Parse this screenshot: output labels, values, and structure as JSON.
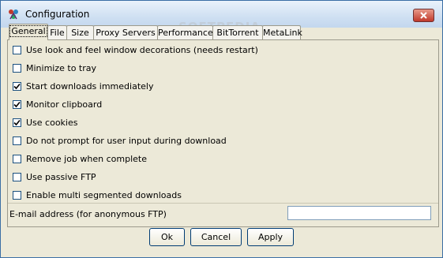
{
  "window": {
    "title": "Configuration"
  },
  "tabs": [
    {
      "label": "General",
      "active": true
    },
    {
      "label": "File",
      "active": false
    },
    {
      "label": "Size",
      "active": false
    },
    {
      "label": "Proxy Servers",
      "active": false
    },
    {
      "label": "Performance",
      "active": false
    },
    {
      "label": "BitTorrent",
      "active": false
    },
    {
      "label": "MetaLink",
      "active": false
    }
  ],
  "options": [
    {
      "label": "Use look and feel window decorations (needs restart)",
      "checked": false
    },
    {
      "label": "Minimize to tray",
      "checked": false
    },
    {
      "label": "Start downloads immediately",
      "checked": true
    },
    {
      "label": "Monitor clipboard",
      "checked": true
    },
    {
      "label": "Use cookies",
      "checked": true
    },
    {
      "label": "Do not prompt for user input during download",
      "checked": false
    },
    {
      "label": "Remove job when complete",
      "checked": false
    },
    {
      "label": "Use passive FTP",
      "checked": false
    },
    {
      "label": "Enable multi segmented downloads",
      "checked": false
    }
  ],
  "email": {
    "label": "E-mail address (for anonymous FTP)",
    "value": ""
  },
  "buttons": {
    "ok": "Ok",
    "cancel": "Cancel",
    "apply": "Apply"
  },
  "watermark": "SOFTPEDIA"
}
